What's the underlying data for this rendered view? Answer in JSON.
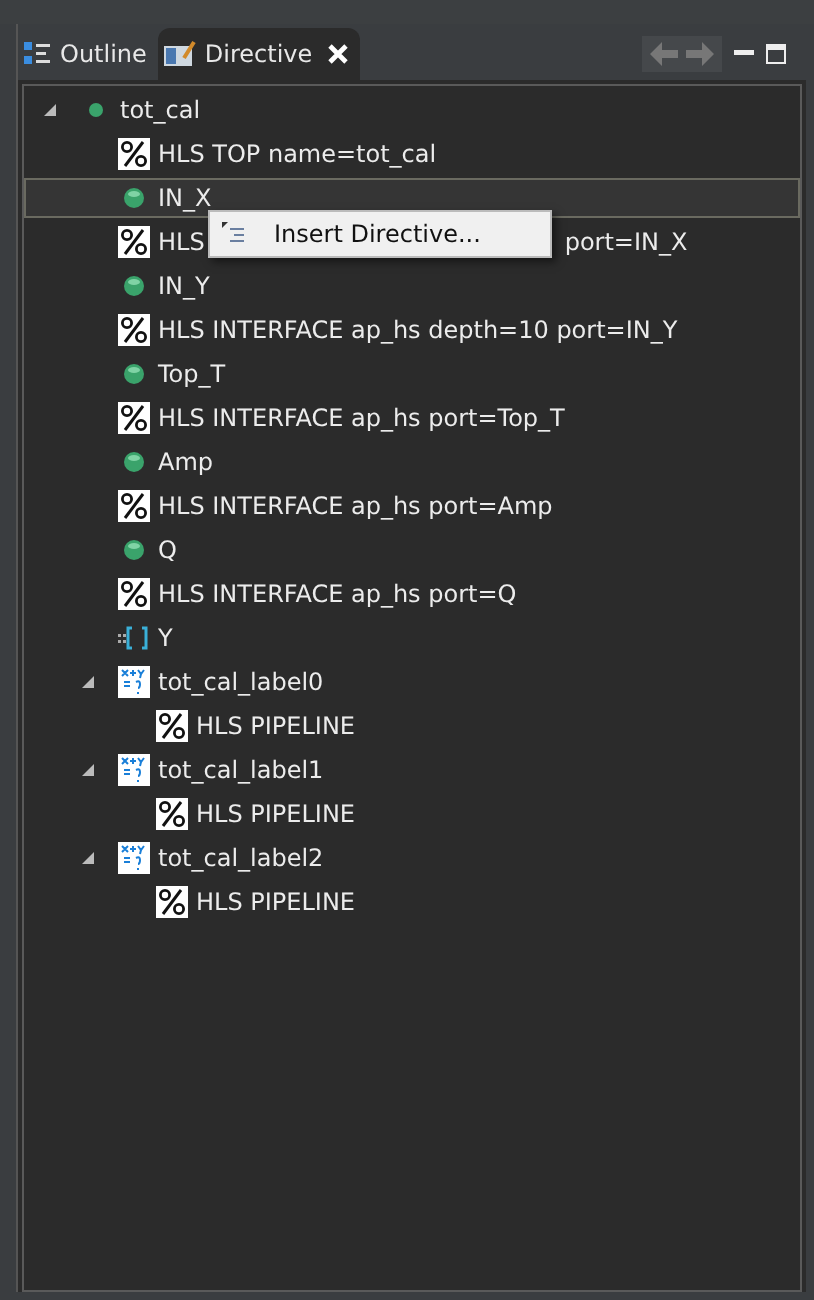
{
  "tabs": [
    {
      "label": "Outline",
      "selected": false,
      "closable": false
    },
    {
      "label": "Directive",
      "selected": true,
      "closable": true
    }
  ],
  "tree": [
    {
      "kind": "function",
      "label": "tot_cal",
      "expanded": true,
      "selected": false,
      "children": [
        {
          "kind": "directive",
          "label": "HLS TOP name=tot_cal",
          "selected": false
        },
        {
          "kind": "port",
          "label": "IN_X",
          "selected": true
        },
        {
          "kind": "directive",
          "label": "HLS",
          "label_tail": "port=IN_X",
          "selected": false
        },
        {
          "kind": "port",
          "label": "IN_Y",
          "selected": false
        },
        {
          "kind": "directive",
          "label": "HLS INTERFACE ap_hs depth=10 port=IN_Y",
          "selected": false
        },
        {
          "kind": "port",
          "label": "Top_T",
          "selected": false
        },
        {
          "kind": "directive",
          "label": "HLS INTERFACE ap_hs port=Top_T",
          "selected": false
        },
        {
          "kind": "port",
          "label": "Amp",
          "selected": false
        },
        {
          "kind": "directive",
          "label": "HLS INTERFACE ap_hs port=Amp",
          "selected": false
        },
        {
          "kind": "port",
          "label": "Q",
          "selected": false
        },
        {
          "kind": "directive",
          "label": "HLS INTERFACE ap_hs port=Q",
          "selected": false
        },
        {
          "kind": "array",
          "label": "Y",
          "selected": false
        },
        {
          "kind": "loop",
          "label": "tot_cal_label0",
          "expanded": true,
          "selected": false,
          "children": [
            {
              "kind": "directive",
              "label": "HLS PIPELINE",
              "selected": false
            }
          ]
        },
        {
          "kind": "loop",
          "label": "tot_cal_label1",
          "expanded": true,
          "selected": false,
          "children": [
            {
              "kind": "directive",
              "label": "HLS PIPELINE",
              "selected": false
            }
          ]
        },
        {
          "kind": "loop",
          "label": "tot_cal_label2",
          "expanded": true,
          "selected": false,
          "children": [
            {
              "kind": "directive",
              "label": "HLS PIPELINE",
              "selected": false
            }
          ]
        }
      ]
    }
  ],
  "context_menu": {
    "items": [
      {
        "label": "Insert Directive..."
      }
    ]
  }
}
